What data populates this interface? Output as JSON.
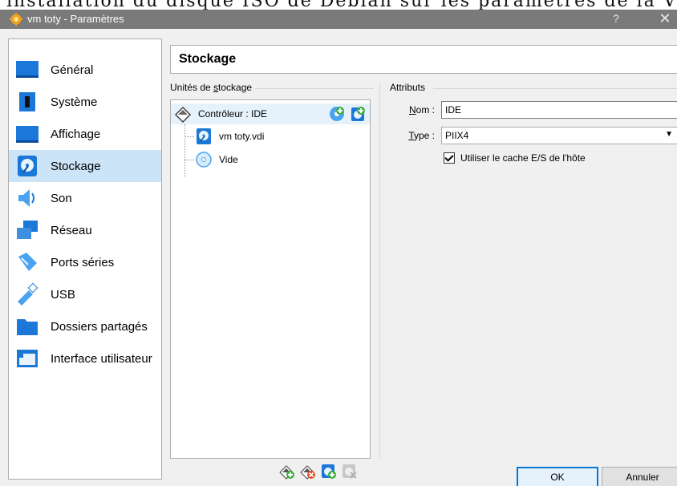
{
  "doc_caption": "installation du disque ISO de Debian sur les paramètres de la VM",
  "window": {
    "title": "vm toty - Paramètres",
    "help": "?",
    "close": "✕"
  },
  "sidebar": {
    "items": [
      {
        "label": "Général",
        "icon": "general-icon"
      },
      {
        "label": "Système",
        "icon": "system-icon"
      },
      {
        "label": "Affichage",
        "icon": "display-icon"
      },
      {
        "label": "Stockage",
        "icon": "storage-icon",
        "selected": true
      },
      {
        "label": "Son",
        "icon": "sound-icon"
      },
      {
        "label": "Réseau",
        "icon": "network-icon"
      },
      {
        "label": "Ports séries",
        "icon": "serial-ports-icon"
      },
      {
        "label": "USB",
        "icon": "usb-icon"
      },
      {
        "label": "Dossiers partagés",
        "icon": "shared-folders-icon"
      },
      {
        "label": "Interface utilisateur",
        "icon": "user-interface-icon"
      }
    ]
  },
  "page": {
    "header": "Stockage"
  },
  "storage_units": {
    "group_title_pre": "Unités de ",
    "group_title_ul": "s",
    "group_title_post": "tockage",
    "controller": "Contrôleur : IDE",
    "children": [
      {
        "label": "vm toty.vdi",
        "icon": "hard-disk-icon"
      },
      {
        "label": "Vide",
        "icon": "optical-disc-icon"
      }
    ]
  },
  "attributes": {
    "group_title": "Attributs",
    "name_label_ul": "N",
    "name_label_rest": "om :",
    "name_value": "IDE",
    "type_label_ul": "T",
    "type_label_rest": "ype :",
    "type_value": "PIIX4",
    "cache_label": "Utiliser le cache E/S de l'hôte",
    "cache_checked": true
  },
  "buttons": {
    "ok": "OK",
    "cancel": "Annuler"
  },
  "colors": {
    "selection": "#cce4f7",
    "titlebar": "#7a7a7a",
    "default_button_border": "#0078d7"
  }
}
